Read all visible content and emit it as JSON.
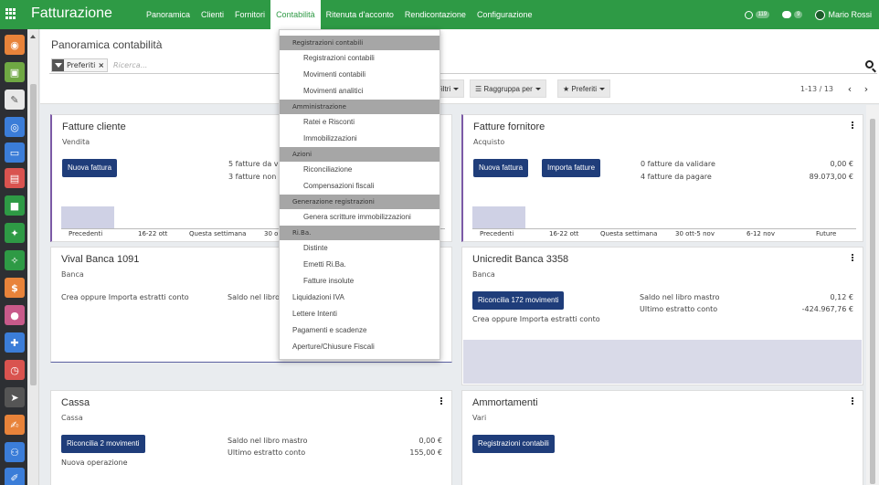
{
  "app": {
    "title": "Fatturazione",
    "accent": "#2e9a45",
    "nav": [
      "Panoramica",
      "Clienti",
      "Fornitori",
      "Contabilità",
      "Ritenuta d'acconto",
      "Rendicontazione",
      "Configurazione"
    ],
    "active_nav": "Contabilità",
    "activity_count": "119",
    "message_count": "9",
    "user": "Mario Rossi"
  },
  "control": {
    "title": "Panoramica contabilità",
    "facet": "Preferiti",
    "search_placeholder": "Ricerca...",
    "filters": "Filtri",
    "group_by": "Raggruppa per",
    "favorites": "Preferiti",
    "pager": "1-13 / 13"
  },
  "rail_icons": [
    "globe-icon",
    "image-icon",
    "paint-icon",
    "lifebuoy-icon",
    "card-icon",
    "box-icon",
    "truck-icon",
    "wrench-icon",
    "wrench-cog-icon",
    "invoice-icon",
    "person-icon",
    "puzzle-icon",
    "timer-icon",
    "send-icon",
    "edit-icon",
    "team-icon",
    "pencil-icon"
  ],
  "menu": {
    "sections": [
      {
        "header": "Registrazioni contabili",
        "items": [
          "Registrazioni contabili",
          "Movimenti contabili",
          "Movimenti analitici"
        ]
      },
      {
        "header": "Amministrazione",
        "items": [
          "Ratei e Risconti",
          "Immobilizzazioni"
        ]
      },
      {
        "header": "Azioni",
        "items": [
          "Riconciliazione",
          "Compensazioni fiscali"
        ]
      },
      {
        "header": "Generazione registrazioni",
        "items": [
          "Genera scritture immobilizzazioni"
        ]
      },
      {
        "header": "Ri.Ba.",
        "items": [
          "Distinte",
          "Emetti Ri.Ba.",
          "Fatture insolute"
        ]
      }
    ],
    "bottom_items": [
      "Liquidazioni IVA",
      "Lettere Intenti",
      "Pagamenti e scadenze",
      "Aperture/Chiusure Fiscali"
    ]
  },
  "cards": {
    "fatture_cliente": {
      "title": "Fatture cliente",
      "subtitle": "Vendita",
      "button": "Nuova fattura",
      "line1": "5 fatture da va",
      "line2": "3 fatture non p",
      "axis": [
        "Precedenti",
        "16-22 ott",
        "Questa settimana",
        "30 o"
      ]
    },
    "fatture_fornitore": {
      "title": "Fatture fornitore",
      "subtitle": "Acquisto",
      "button": "Nuova fattura",
      "button2": "Importa fatture",
      "line1": "0 fatture da validare",
      "line1_val": "0,00 €",
      "line2": "4 fatture da pagare",
      "line2_val": "89.073,00 €",
      "axis": [
        "Precedenti",
        "16-22 ott",
        "Questa settimana",
        "30 ott-5 nov",
        "6-12 nov",
        "Future"
      ]
    },
    "vival": {
      "title": "Vival Banca 1091",
      "subtitle": "Banca",
      "line1": "Crea oppure Importa estratti conto",
      "line2": "Saldo nel libro"
    },
    "unicredit": {
      "title": "Unicredit Banca 3358",
      "subtitle": "Banca",
      "button": "Riconcilia 172 movimenti",
      "line1": "Crea oppure Importa estratti conto",
      "saldo_label": "Saldo nel libro mastro",
      "saldo_val": "0,12 €",
      "ultimo_label": "Ultimo estratto conto",
      "ultimo_val": "-424.967,76 €"
    },
    "cassa": {
      "title": "Cassa",
      "subtitle": "Cassa",
      "button": "Riconcilia 2 movimenti",
      "line1": "Nuova operazione",
      "saldo_label": "Saldo nel libro mastro",
      "saldo_val": "0,00 €",
      "ultimo_label": "Ultimo estratto conto",
      "ultimo_val": "155,00 €"
    },
    "ammortamenti": {
      "title": "Ammortamenti",
      "subtitle": "Vari",
      "button": "Registrazioni contabili"
    }
  }
}
